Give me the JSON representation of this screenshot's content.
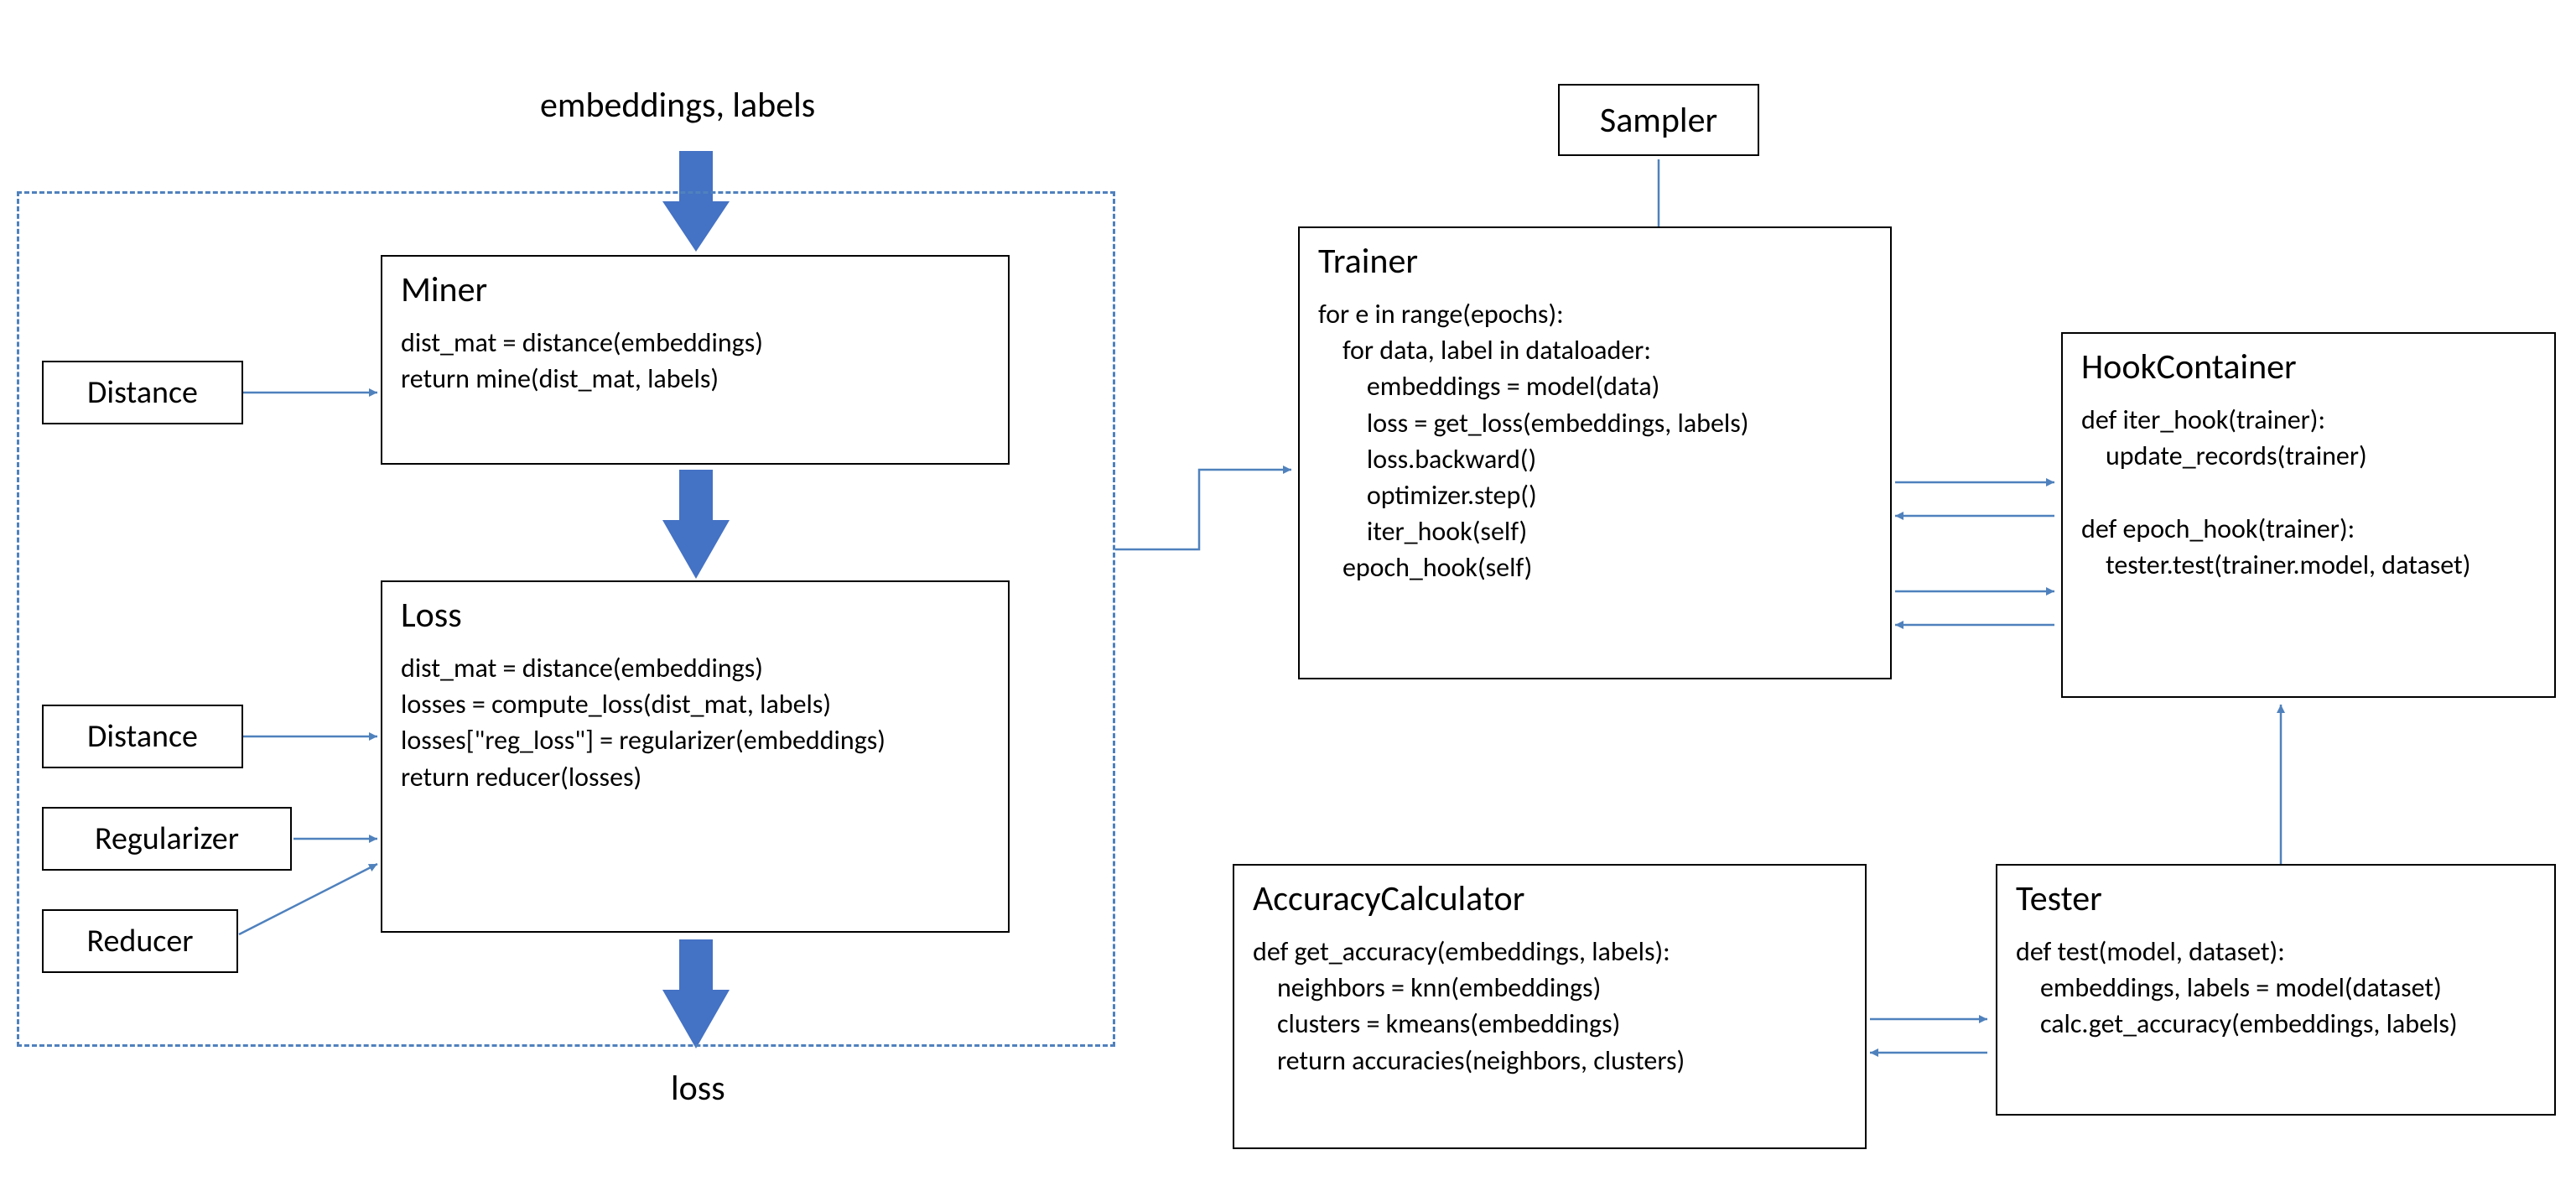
{
  "top_label": "embeddings, labels",
  "bottom_label": "loss",
  "miner": {
    "title": "Miner",
    "code": "dist_mat = distance(embeddings)\nreturn mine(dist_mat, labels)"
  },
  "loss": {
    "title": "Loss",
    "code": "dist_mat = distance(embeddings)\nlosses = compute_loss(dist_mat, labels)\nlosses[\"reg_loss\"] = regularizer(embeddings)\nreturn reducer(losses)"
  },
  "distance1": "Distance",
  "distance2": "Distance",
  "regularizer": "Regularizer",
  "reducer": "Reducer",
  "sampler": "Sampler",
  "trainer": {
    "title": "Trainer",
    "code": "for e in range(epochs):\n    for data, label in dataloader:\n        embeddings = model(data)\n        loss = get_loss(embeddings, labels)\n        loss.backward()\n        optimizer.step()\n        iter_hook(self)\n    epoch_hook(self)"
  },
  "hook": {
    "title": "HookContainer",
    "code": "def iter_hook(trainer):\n    update_records(trainer)\n\ndef epoch_hook(trainer):\n    tester.test(trainer.model, dataset)"
  },
  "acc": {
    "title": "AccuracyCalculator",
    "code": "def get_accuracy(embeddings, labels):\n    neighbors = knn(embeddings)\n    clusters = kmeans(embeddings)\n    return accuracies(neighbors, clusters)"
  },
  "tester": {
    "title": "Tester",
    "code": "def test(model, dataset):\n    embeddings, labels = model(dataset)\n    calc.get_accuracy(embeddings, labels)"
  },
  "colors": {
    "thick_arrow": "#4472C4",
    "thin_arrow": "#4F81BD"
  }
}
